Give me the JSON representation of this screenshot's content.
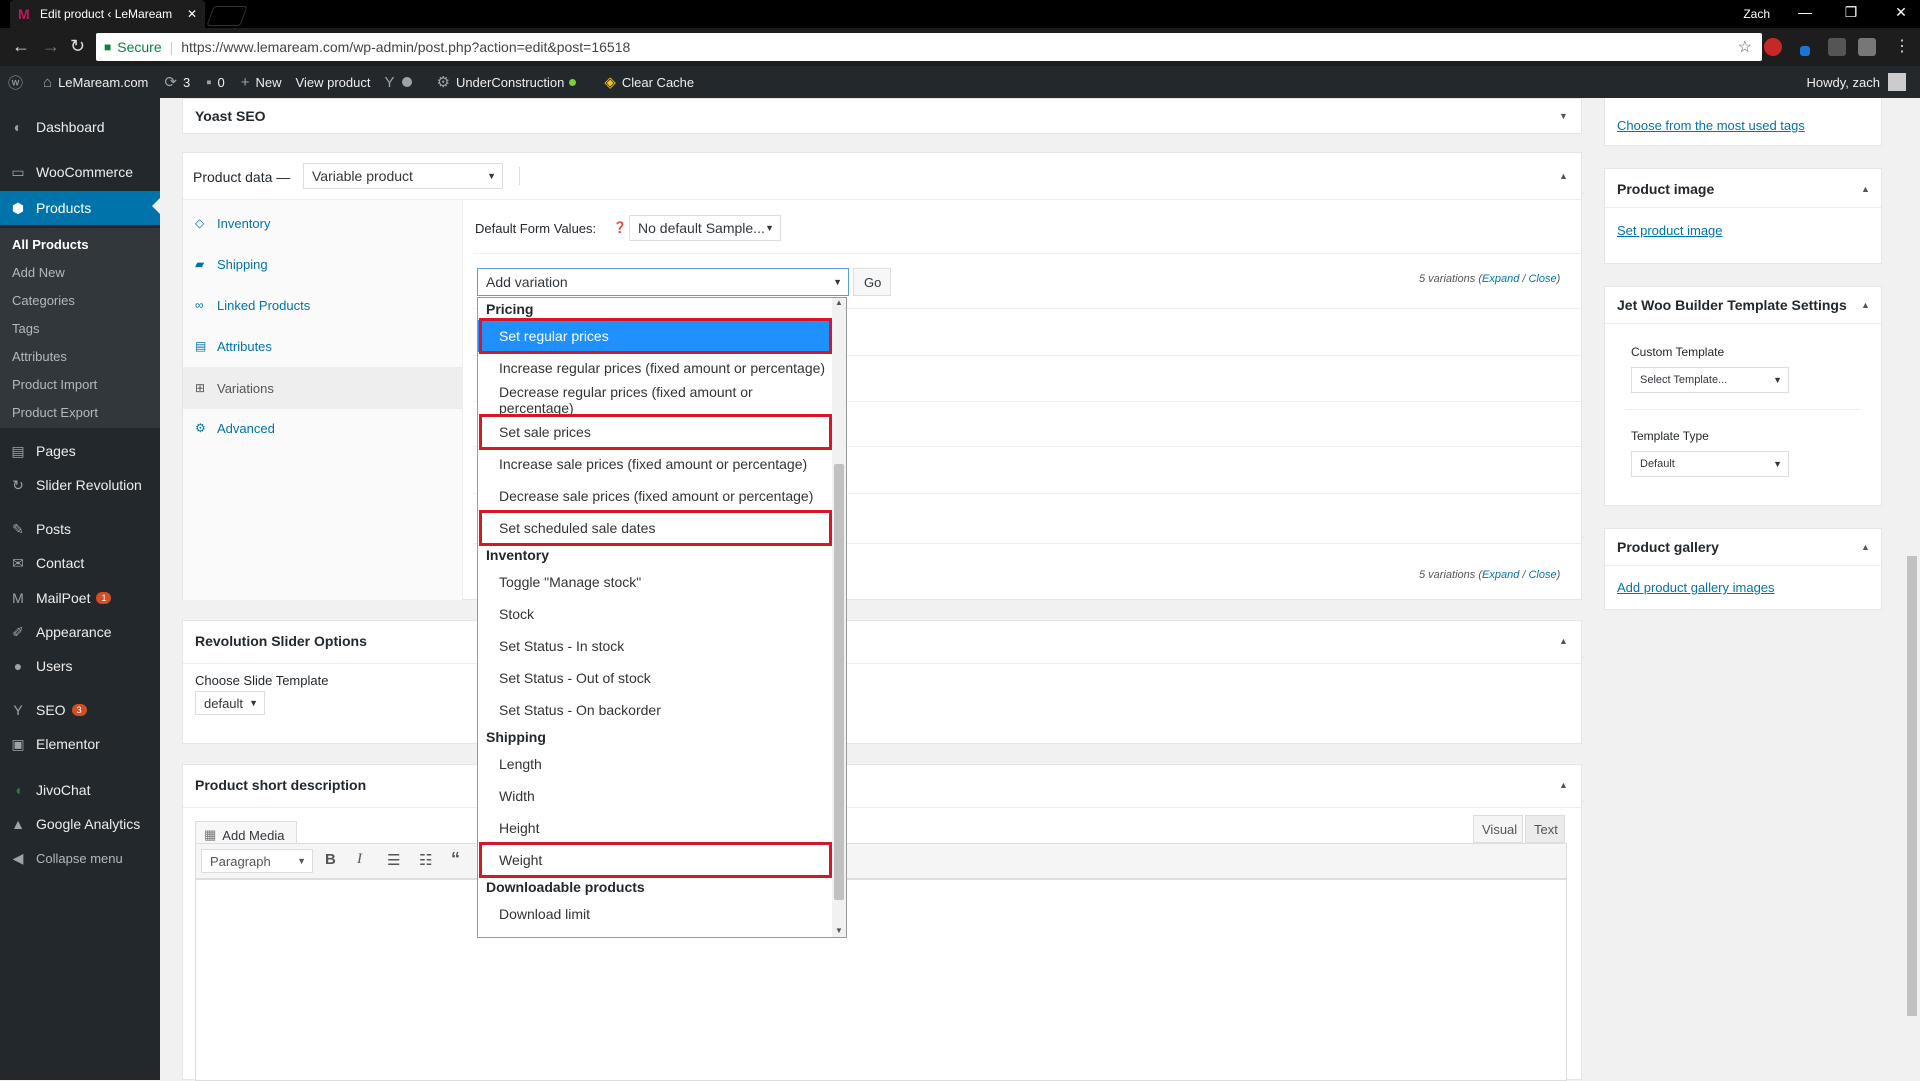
{
  "browser": {
    "tab_title": "Edit product ‹ LeMaream",
    "tab_close": "✕",
    "window_user": "Zach",
    "secure_label": "Secure",
    "url": "https://www.lemaream.com/wp-admin/post.php?action=edit&post=16518"
  },
  "adminbar": {
    "site_name": "LeMaream.com",
    "updates_count": "3",
    "comments_count": "0",
    "new_label": "New",
    "view_product": "View product",
    "under_construction": "UnderConstruction",
    "clear_cache": "Clear Cache",
    "howdy": "Howdy, zach"
  },
  "sidebar": {
    "items": [
      {
        "label": "Dashboard"
      },
      {
        "label": "WooCommerce"
      },
      {
        "label": "Products"
      },
      {
        "label": "Pages"
      },
      {
        "label": "Slider Revolution"
      },
      {
        "label": "Posts"
      },
      {
        "label": "Contact"
      },
      {
        "label": "MailPoet",
        "badge": "1"
      },
      {
        "label": "Appearance"
      },
      {
        "label": "Users"
      },
      {
        "label": "SEO",
        "badge": "3"
      },
      {
        "label": "Elementor"
      },
      {
        "label": "JivoChat"
      },
      {
        "label": "Google Analytics"
      },
      {
        "label": "Collapse menu"
      }
    ],
    "submenu": [
      "All Products",
      "Add New",
      "Categories",
      "Tags",
      "Attributes",
      "Product Import",
      "Product Export"
    ]
  },
  "yoast": {
    "title": "Yoast SEO"
  },
  "product_data": {
    "title": "Product data —",
    "type_select": "Variable product",
    "tabs": [
      "Inventory",
      "Shipping",
      "Linked Products",
      "Attributes",
      "Variations",
      "Advanced"
    ],
    "default_form_label": "Default Form Values:",
    "default_form_select": "No default Sample...",
    "variation_select": "Add variation",
    "go_button": "Go",
    "variations_count": "5 variations",
    "expand": "Expand",
    "close": "Close"
  },
  "dropdown": {
    "groups": [
      {
        "label": "Pricing",
        "options": [
          "Set regular prices",
          "Increase regular prices (fixed amount or percentage)",
          "Decrease regular prices (fixed amount or percentage)",
          "Set sale prices",
          "Increase sale prices (fixed amount or percentage)",
          "Decrease sale prices (fixed amount or percentage)",
          "Set scheduled sale dates"
        ]
      },
      {
        "label": "Inventory",
        "options": [
          "Toggle \"Manage stock\"",
          "Stock",
          "Set Status - In stock",
          "Set Status - Out of stock",
          "Set Status - On backorder"
        ]
      },
      {
        "label": "Shipping",
        "options": [
          "Length",
          "Width",
          "Height",
          "Weight"
        ]
      },
      {
        "label": "Downloadable products",
        "options": [
          "Download limit"
        ]
      }
    ],
    "selected": "Set regular prices",
    "highlighted": [
      "Set regular prices",
      "Set sale prices",
      "Set scheduled sale dates",
      "Weight"
    ]
  },
  "rev_slider": {
    "title": "Revolution Slider Options",
    "template_label": "Choose Slide Template",
    "template_value": "default"
  },
  "short_desc": {
    "title": "Product short description",
    "add_media": "Add Media",
    "visual_tab": "Visual",
    "text_tab": "Text",
    "format_select": "Paragraph"
  },
  "right": {
    "tags_link": "Choose from the most used tags",
    "product_image_title": "Product image",
    "set_image_link": "Set product image",
    "jet_title": "Jet Woo Builder Template Settings",
    "custom_template_label": "Custom Template",
    "custom_template_value": "Select Template...",
    "template_type_label": "Template Type",
    "template_type_value": "Default",
    "gallery_title": "Product gallery",
    "gallery_link": "Add product gallery images"
  },
  "colors": {
    "highlight": "#d3182a",
    "selected": "#1e90ff",
    "wp_blue": "#0073aa",
    "sidebar": "#23282d"
  }
}
